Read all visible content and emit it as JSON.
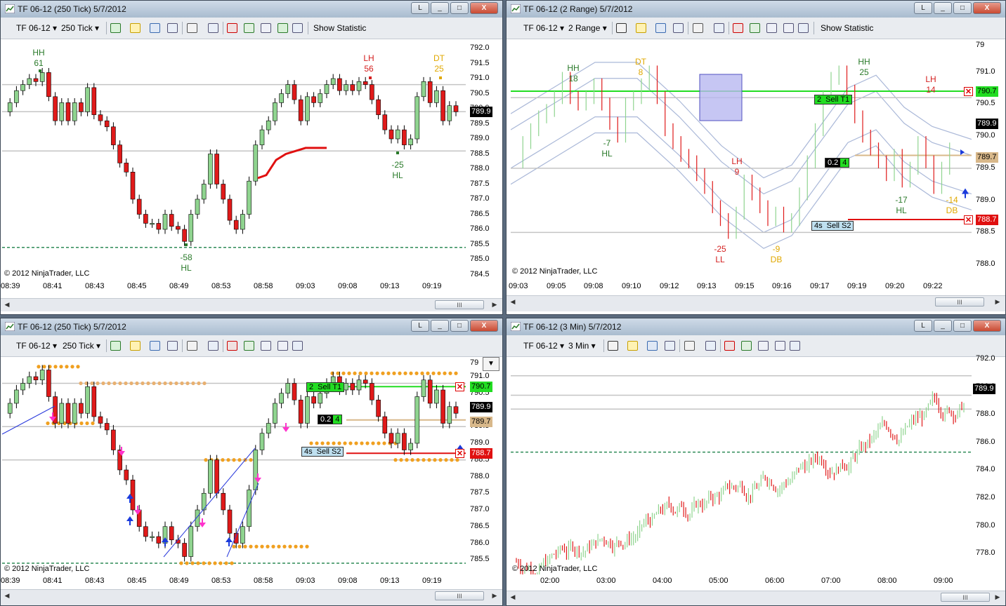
{
  "windows": {
    "tl": {
      "title": "TF 06-12 (250 Tick)  5/7/2012",
      "instrument": "TF 06-12",
      "interval": "250 Tick",
      "show_statistic": "Show Statistic",
      "yticks": [
        "792.0",
        "791.5",
        "791.0",
        "790.5",
        "790.0",
        "789.5",
        "789.0",
        "788.5",
        "788.0",
        "787.5",
        "787.0",
        "786.5",
        "786.0",
        "785.5",
        "785.0",
        "784.5"
      ],
      "xticks": [
        "08:39",
        "08:41",
        "08:43",
        "08:45",
        "08:49",
        "08:53",
        "08:58",
        "09:03",
        "09:08",
        "09:13",
        "09:19"
      ],
      "last_price": "789.9",
      "copyright": "© 2012 NinjaTrader, LLC",
      "labels": [
        {
          "a": "HH",
          "b": "61",
          "color": "#2a7a2a"
        },
        {
          "a": "LH",
          "b": "56",
          "color": "#d42020"
        },
        {
          "a": "DT",
          "b": "25",
          "color": "#e0a800"
        },
        {
          "a": "-25",
          "b": "HL",
          "color": "#2a7a2a"
        },
        {
          "a": "-58",
          "b": "HL",
          "color": "#2a7a2a"
        }
      ],
      "scroll_thumb": "III"
    },
    "tr": {
      "title": "TF 06-12 (2 Range)  5/7/2012",
      "instrument": "TF 06-12",
      "interval": "2 Range",
      "show_statistic": "Show Statistic",
      "yticks": [
        "791.0",
        "790.5",
        "790.0",
        "789.5",
        "789.0",
        "788.5",
        "788.0"
      ],
      "ytick_top": "79",
      "xticks": [
        "09:03",
        "09:05",
        "09:08",
        "09:10",
        "09:12",
        "09:13",
        "09:15",
        "09:16",
        "09:17",
        "09:19",
        "09:20",
        "09:22"
      ],
      "last_price": "789.9",
      "tag_green": "790.7",
      "tag_tan": "789.7",
      "tag_red": "788.7",
      "order_t1": {
        "qty": "2",
        "text": "Sell T1"
      },
      "order_mid": {
        "a": "0.2",
        "b": "4"
      },
      "order_s2": {
        "qty": "4s",
        "text": "Sell S2"
      },
      "copyright": "© 2012 NinjaTrader, LLC",
      "labels": [
        {
          "a": "HH",
          "b": "18",
          "color": "#2a7a2a"
        },
        {
          "a": "DT",
          "b": "8",
          "color": "#e0a800"
        },
        {
          "a": "-7",
          "b": "HL",
          "color": "#2a7a2a"
        },
        {
          "a": "LH",
          "b": "9",
          "color": "#d42020"
        },
        {
          "a": "-25",
          "b": "LL",
          "color": "#d42020"
        },
        {
          "a": "-9",
          "b": "DB",
          "color": "#e0a800"
        },
        {
          "a": "HH",
          "b": "25",
          "color": "#2a7a2a"
        },
        {
          "a": "LH",
          "b": "14",
          "color": "#d42020"
        },
        {
          "a": "-17",
          "b": "HL",
          "color": "#2a7a2a"
        },
        {
          "a": "-14",
          "b": "DB",
          "color": "#e0a800"
        }
      ],
      "scroll_thumb": "III"
    },
    "bl": {
      "title": "TF 06-12 (250 Tick)  5/7/2012",
      "instrument": "TF 06-12",
      "interval": "250 Tick",
      "yticks": [
        "791.0",
        "790.5",
        "790.0",
        "789.5",
        "789.0",
        "788.5",
        "788.0",
        "787.5",
        "787.0",
        "786.5",
        "786.0",
        "785.5"
      ],
      "ytick_top": "79",
      "xticks": [
        "08:39",
        "08:41",
        "08:43",
        "08:45",
        "08:49",
        "08:53",
        "08:58",
        "09:03",
        "09:08",
        "09:13",
        "09:19"
      ],
      "last_price": "789.9",
      "tag_green": "790.7",
      "tag_tan": "789.7",
      "tag_red": "788.7",
      "order_t1": {
        "qty": "2",
        "text": "Sell T1"
      },
      "order_mid": {
        "a": "0.2",
        "b": "4"
      },
      "order_s2": {
        "qty": "4s",
        "text": "Sell S2"
      },
      "copyright": "© 2012 NinjaTrader, LLC",
      "scroll_thumb": "III"
    },
    "br": {
      "title": "TF 06-12 (3 Min)  5/7/2012",
      "instrument": "TF 06-12",
      "interval": "3 Min",
      "yticks": [
        "792.0",
        "790.0",
        "788.0",
        "786.0",
        "784.0",
        "782.0",
        "780.0",
        "778.0"
      ],
      "xticks": [
        "02:00",
        "03:00",
        "04:00",
        "05:00",
        "06:00",
        "07:00",
        "08:00",
        "09:00"
      ],
      "last_price": "789.9",
      "copyright": "© 2012 NinjaTrader, LLC",
      "scroll_thumb": "III"
    }
  },
  "window_buttons": {
    "min": "_",
    "max": "□",
    "close": "X",
    "lock": "L"
  },
  "colors": {
    "up": "#8fd48f",
    "down": "#e01a1a",
    "green_line": "#22dd22",
    "red_line": "#e01010",
    "tan_line": "#d8b88a",
    "gray_line": "#bdbdbd",
    "dash": "#2e8b57",
    "orange": "#f0a020",
    "blue_band": "#aab8d8"
  }
}
